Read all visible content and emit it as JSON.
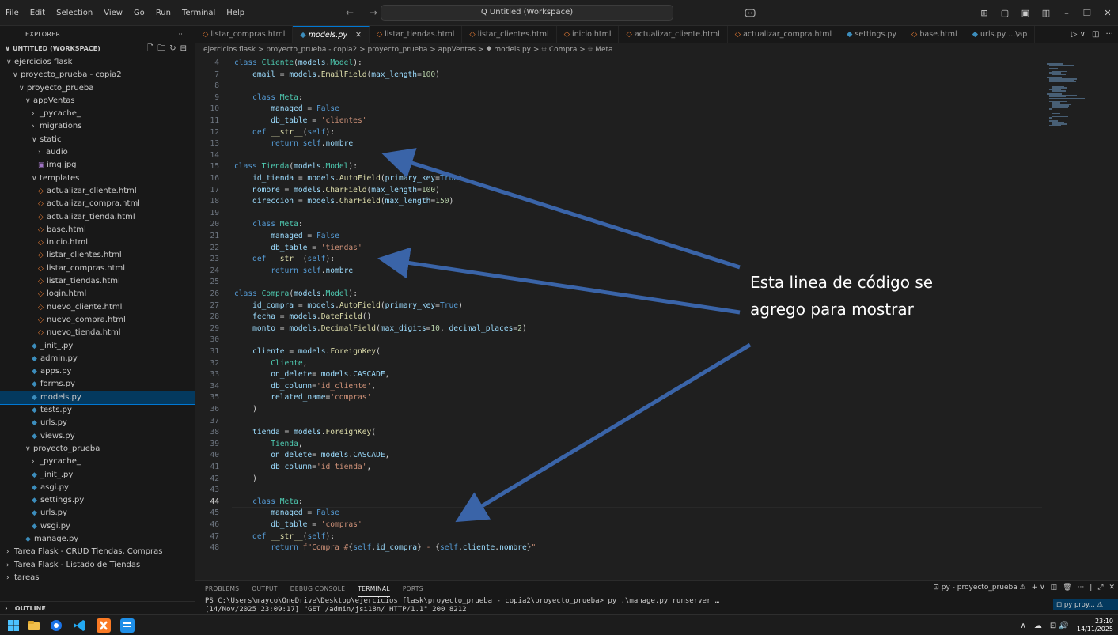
{
  "menu": [
    "File",
    "Edit",
    "Selection",
    "View",
    "Go",
    "Run",
    "Terminal",
    "Help"
  ],
  "nav_arrows": "← →",
  "command_center": "Q Untitled (Workspace)",
  "window_controls": [
    "⊞",
    "▢",
    "▣",
    "▥",
    "–",
    "❐",
    "✕"
  ],
  "explorer": {
    "title": "EXPLORER",
    "more": "···",
    "workspace": "UNTITLED (WORKSPACE)",
    "ws_actions": [
      "🗋",
      "🗀",
      "↻",
      "⊟"
    ],
    "tree": [
      {
        "label": "ejercicios flask",
        "indent": 0,
        "type": "folder",
        "open": true
      },
      {
        "label": "proyecto_prueba - copia2",
        "indent": 1,
        "type": "folder",
        "open": true
      },
      {
        "label": "proyecto_prueba",
        "indent": 2,
        "type": "folder",
        "open": true
      },
      {
        "label": "appVentas",
        "indent": 3,
        "type": "folder",
        "open": true
      },
      {
        "label": "_pycache_",
        "indent": 4,
        "type": "folder",
        "open": false
      },
      {
        "label": "migrations",
        "indent": 4,
        "type": "folder",
        "open": false
      },
      {
        "label": "static",
        "indent": 4,
        "type": "folder",
        "open": true
      },
      {
        "label": "audio",
        "indent": 5,
        "type": "folder",
        "open": false
      },
      {
        "label": "img.jpg",
        "indent": 5,
        "type": "img"
      },
      {
        "label": "templates",
        "indent": 4,
        "type": "folder",
        "open": true
      },
      {
        "label": "actualizar_cliente.html",
        "indent": 5,
        "type": "html"
      },
      {
        "label": "actualizar_compra.html",
        "indent": 5,
        "type": "html"
      },
      {
        "label": "actualizar_tienda.html",
        "indent": 5,
        "type": "html"
      },
      {
        "label": "base.html",
        "indent": 5,
        "type": "html"
      },
      {
        "label": "inicio.html",
        "indent": 5,
        "type": "html"
      },
      {
        "label": "listar_clientes.html",
        "indent": 5,
        "type": "html"
      },
      {
        "label": "listar_compras.html",
        "indent": 5,
        "type": "html"
      },
      {
        "label": "listar_tiendas.html",
        "indent": 5,
        "type": "html"
      },
      {
        "label": "login.html",
        "indent": 5,
        "type": "html"
      },
      {
        "label": "nuevo_cliente.html",
        "indent": 5,
        "type": "html"
      },
      {
        "label": "nuevo_compra.html",
        "indent": 5,
        "type": "html"
      },
      {
        "label": "nuevo_tienda.html",
        "indent": 5,
        "type": "html"
      },
      {
        "label": "_init_.py",
        "indent": 4,
        "type": "py"
      },
      {
        "label": "admin.py",
        "indent": 4,
        "type": "py"
      },
      {
        "label": "apps.py",
        "indent": 4,
        "type": "py"
      },
      {
        "label": "forms.py",
        "indent": 4,
        "type": "py"
      },
      {
        "label": "models.py",
        "indent": 4,
        "type": "py",
        "selected": true
      },
      {
        "label": "tests.py",
        "indent": 4,
        "type": "py"
      },
      {
        "label": "urls.py",
        "indent": 4,
        "type": "py"
      },
      {
        "label": "views.py",
        "indent": 4,
        "type": "py"
      },
      {
        "label": "proyecto_prueba",
        "indent": 3,
        "type": "folder",
        "open": true
      },
      {
        "label": "_pycache_",
        "indent": 4,
        "type": "folder",
        "open": false
      },
      {
        "label": "_init_.py",
        "indent": 4,
        "type": "py"
      },
      {
        "label": "asgi.py",
        "indent": 4,
        "type": "py"
      },
      {
        "label": "settings.py",
        "indent": 4,
        "type": "py"
      },
      {
        "label": "urls.py",
        "indent": 4,
        "type": "py"
      },
      {
        "label": "wsgi.py",
        "indent": 4,
        "type": "py"
      },
      {
        "label": "manage.py",
        "indent": 3,
        "type": "py"
      },
      {
        "label": "Tarea Flask - CRUD Tiendas, Compras",
        "indent": 0,
        "type": "folder",
        "open": false
      },
      {
        "label": "Tarea Flask - Listado de Tiendas",
        "indent": 0,
        "type": "folder",
        "open": false
      },
      {
        "label": "tareas",
        "indent": 0,
        "type": "folder",
        "open": false
      }
    ],
    "outline": "OUTLINE"
  },
  "tabs": [
    {
      "label": "listar_compras.html",
      "type": "html"
    },
    {
      "label": "models.py",
      "type": "py",
      "active": true
    },
    {
      "label": "listar_tiendas.html",
      "type": "html"
    },
    {
      "label": "listar_clientes.html",
      "type": "html"
    },
    {
      "label": "inicio.html",
      "type": "html"
    },
    {
      "label": "actualizar_cliente.html",
      "type": "html"
    },
    {
      "label": "actualizar_compra.html",
      "type": "html"
    },
    {
      "label": "settings.py",
      "type": "py"
    },
    {
      "label": "base.html",
      "type": "html"
    },
    {
      "label": "urls.py ...\\ap",
      "type": "py"
    }
  ],
  "tab_actions": [
    "▷ ∨",
    "◫",
    "···"
  ],
  "breadcrumb": "ejercicios flask > proyecto_prueba - copia2 > proyecto_prueba > appVentas > ⯁ models.py > ⯐ Compra > ⯐ Meta",
  "code": [
    {
      "ln": "4",
      "segs": [
        [
          "kw",
          "class "
        ],
        [
          "cls",
          "Cliente"
        ],
        [
          "",
          "("
        ],
        [
          "var",
          "models"
        ],
        [
          "",
          "."
        ],
        [
          "cls",
          "Model"
        ],
        [
          "",
          "):"
        ]
      ]
    },
    {
      "ln": "7",
      "segs": [
        [
          "var",
          "    email"
        ],
        [
          "",
          " = "
        ],
        [
          "var",
          "models"
        ],
        [
          "",
          "."
        ],
        [
          "fn",
          "EmailField"
        ],
        [
          "",
          "("
        ],
        [
          "var",
          "max_length"
        ],
        [
          "",
          "="
        ],
        [
          "num",
          "100"
        ],
        [
          "",
          ")"
        ]
      ]
    },
    {
      "ln": "8",
      "segs": []
    },
    {
      "ln": "9",
      "segs": [
        [
          "kw",
          "    class "
        ],
        [
          "cls",
          "Meta"
        ],
        [
          "",
          ":"
        ]
      ]
    },
    {
      "ln": "10",
      "segs": [
        [
          "var",
          "        managed"
        ],
        [
          "",
          " = "
        ],
        [
          "kw",
          "False"
        ]
      ]
    },
    {
      "ln": "11",
      "segs": [
        [
          "var",
          "        db_table"
        ],
        [
          "",
          " = "
        ],
        [
          "str",
          "'clientes'"
        ]
      ]
    },
    {
      "ln": "12",
      "segs": [
        [
          "kw",
          "    def "
        ],
        [
          "fn",
          "__str__"
        ],
        [
          "",
          "("
        ],
        [
          "self",
          "self"
        ],
        [
          "",
          "):"
        ]
      ]
    },
    {
      "ln": "13",
      "segs": [
        [
          "kw",
          "        return "
        ],
        [
          "self",
          "self"
        ],
        [
          "",
          "."
        ],
        [
          "var",
          "nombre"
        ]
      ]
    },
    {
      "ln": "14",
      "segs": []
    },
    {
      "ln": "15",
      "segs": [
        [
          "kw",
          "class "
        ],
        [
          "cls",
          "Tienda"
        ],
        [
          "",
          "("
        ],
        [
          "var",
          "models"
        ],
        [
          "",
          "."
        ],
        [
          "cls",
          "Model"
        ],
        [
          "",
          "):"
        ]
      ]
    },
    {
      "ln": "16",
      "segs": [
        [
          "var",
          "    id_tienda"
        ],
        [
          "",
          " = "
        ],
        [
          "var",
          "models"
        ],
        [
          "",
          "."
        ],
        [
          "fn",
          "AutoField"
        ],
        [
          "",
          "("
        ],
        [
          "var",
          "primary_key"
        ],
        [
          "",
          "="
        ],
        [
          "kw",
          "True"
        ],
        [
          "",
          ")"
        ]
      ]
    },
    {
      "ln": "17",
      "segs": [
        [
          "var",
          "    nombre"
        ],
        [
          "",
          " = "
        ],
        [
          "var",
          "models"
        ],
        [
          "",
          "."
        ],
        [
          "fn",
          "CharField"
        ],
        [
          "",
          "("
        ],
        [
          "var",
          "max_length"
        ],
        [
          "",
          "="
        ],
        [
          "num",
          "100"
        ],
        [
          "",
          ")"
        ]
      ]
    },
    {
      "ln": "18",
      "segs": [
        [
          "var",
          "    direccion"
        ],
        [
          "",
          " = "
        ],
        [
          "var",
          "models"
        ],
        [
          "",
          "."
        ],
        [
          "fn",
          "CharField"
        ],
        [
          "",
          "("
        ],
        [
          "var",
          "max_length"
        ],
        [
          "",
          "="
        ],
        [
          "num",
          "150"
        ],
        [
          "",
          ")"
        ]
      ]
    },
    {
      "ln": "19",
      "segs": []
    },
    {
      "ln": "20",
      "segs": [
        [
          "kw",
          "    class "
        ],
        [
          "cls",
          "Meta"
        ],
        [
          "",
          ":"
        ]
      ]
    },
    {
      "ln": "21",
      "segs": [
        [
          "var",
          "        managed"
        ],
        [
          "",
          " = "
        ],
        [
          "kw",
          "False"
        ]
      ]
    },
    {
      "ln": "22",
      "segs": [
        [
          "var",
          "        db_table"
        ],
        [
          "",
          " = "
        ],
        [
          "str",
          "'tiendas'"
        ]
      ]
    },
    {
      "ln": "23",
      "segs": [
        [
          "kw",
          "    def "
        ],
        [
          "fn",
          "__str__"
        ],
        [
          "",
          "("
        ],
        [
          "self",
          "self"
        ],
        [
          "",
          "):"
        ]
      ]
    },
    {
      "ln": "24",
      "segs": [
        [
          "kw",
          "        return "
        ],
        [
          "self",
          "self"
        ],
        [
          "",
          "."
        ],
        [
          "var",
          "nombre"
        ]
      ]
    },
    {
      "ln": "25",
      "segs": []
    },
    {
      "ln": "26",
      "segs": [
        [
          "kw",
          "class "
        ],
        [
          "cls",
          "Compra"
        ],
        [
          "",
          "("
        ],
        [
          "var",
          "models"
        ],
        [
          "",
          "."
        ],
        [
          "cls",
          "Model"
        ],
        [
          "",
          "):"
        ]
      ]
    },
    {
      "ln": "27",
      "segs": [
        [
          "var",
          "    id_compra"
        ],
        [
          "",
          " = "
        ],
        [
          "var",
          "models"
        ],
        [
          "",
          "."
        ],
        [
          "fn",
          "AutoField"
        ],
        [
          "",
          "("
        ],
        [
          "var",
          "primary_key"
        ],
        [
          "",
          "="
        ],
        [
          "kw",
          "True"
        ],
        [
          "",
          ")"
        ]
      ]
    },
    {
      "ln": "28",
      "segs": [
        [
          "var",
          "    fecha"
        ],
        [
          "",
          " = "
        ],
        [
          "var",
          "models"
        ],
        [
          "",
          "."
        ],
        [
          "fn",
          "DateField"
        ],
        [
          "",
          "()"
        ]
      ]
    },
    {
      "ln": "29",
      "segs": [
        [
          "var",
          "    monto"
        ],
        [
          "",
          " = "
        ],
        [
          "var",
          "models"
        ],
        [
          "",
          "."
        ],
        [
          "fn",
          "DecimalField"
        ],
        [
          "",
          "("
        ],
        [
          "var",
          "max_digits"
        ],
        [
          "",
          "="
        ],
        [
          "num",
          "10"
        ],
        [
          "",
          ", "
        ],
        [
          "var",
          "decimal_places"
        ],
        [
          "",
          "="
        ],
        [
          "num",
          "2"
        ],
        [
          "",
          ")"
        ]
      ]
    },
    {
      "ln": "30",
      "segs": []
    },
    {
      "ln": "31",
      "segs": [
        [
          "var",
          "    cliente"
        ],
        [
          "",
          " = "
        ],
        [
          "var",
          "models"
        ],
        [
          "",
          "."
        ],
        [
          "fn",
          "ForeignKey"
        ],
        [
          "",
          "("
        ]
      ]
    },
    {
      "ln": "32",
      "segs": [
        [
          "cls",
          "        Cliente"
        ],
        [
          "",
          ","
        ]
      ]
    },
    {
      "ln": "33",
      "segs": [
        [
          "var",
          "        on_delete"
        ],
        [
          "",
          "= "
        ],
        [
          "var",
          "models"
        ],
        [
          "",
          "."
        ],
        [
          "var",
          "CASCADE"
        ],
        [
          "",
          ","
        ]
      ]
    },
    {
      "ln": "34",
      "segs": [
        [
          "var",
          "        db_column"
        ],
        [
          "",
          "="
        ],
        [
          "str",
          "'id_cliente'"
        ],
        [
          "",
          ","
        ]
      ]
    },
    {
      "ln": "35",
      "segs": [
        [
          "var",
          "        related_name"
        ],
        [
          "",
          "="
        ],
        [
          "str",
          "'compras'"
        ]
      ]
    },
    {
      "ln": "36",
      "segs": [
        [
          "",
          "    )"
        ]
      ]
    },
    {
      "ln": "37",
      "segs": []
    },
    {
      "ln": "38",
      "segs": [
        [
          "var",
          "    tienda"
        ],
        [
          "",
          " = "
        ],
        [
          "var",
          "models"
        ],
        [
          "",
          "."
        ],
        [
          "fn",
          "ForeignKey"
        ],
        [
          "",
          "("
        ]
      ]
    },
    {
      "ln": "39",
      "segs": [
        [
          "cls",
          "        Tienda"
        ],
        [
          "",
          ","
        ]
      ]
    },
    {
      "ln": "40",
      "segs": [
        [
          "var",
          "        on_delete"
        ],
        [
          "",
          "= "
        ],
        [
          "var",
          "models"
        ],
        [
          "",
          "."
        ],
        [
          "var",
          "CASCADE"
        ],
        [
          "",
          ","
        ]
      ]
    },
    {
      "ln": "41",
      "segs": [
        [
          "var",
          "        db_column"
        ],
        [
          "",
          "="
        ],
        [
          "str",
          "'id_tienda'"
        ],
        [
          "",
          ","
        ]
      ]
    },
    {
      "ln": "42",
      "segs": [
        [
          "",
          "    )"
        ]
      ]
    },
    {
      "ln": "43",
      "segs": []
    },
    {
      "ln": "44",
      "segs": [
        [
          "kw",
          "    class "
        ],
        [
          "cls",
          "Meta"
        ],
        [
          "",
          ":"
        ]
      ],
      "current": true
    },
    {
      "ln": "45",
      "segs": [
        [
          "var",
          "        managed"
        ],
        [
          "",
          " = "
        ],
        [
          "kw",
          "False"
        ]
      ]
    },
    {
      "ln": "46",
      "segs": [
        [
          "var",
          "        db_table"
        ],
        [
          "",
          " = "
        ],
        [
          "str",
          "'compras'"
        ]
      ]
    },
    {
      "ln": "47",
      "segs": [
        [
          "kw",
          "    def "
        ],
        [
          "fn",
          "__str__"
        ],
        [
          "",
          "("
        ],
        [
          "self",
          "self"
        ],
        [
          "",
          "):"
        ]
      ]
    },
    {
      "ln": "48",
      "segs": [
        [
          "kw",
          "        return "
        ],
        [
          "str",
          "f\"Compra #"
        ],
        [
          "",
          "{"
        ],
        [
          "self",
          "self"
        ],
        [
          "",
          "."
        ],
        [
          "var",
          "id_compra"
        ],
        [
          "",
          "}"
        ],
        [
          "str",
          " - "
        ],
        [
          "",
          "{"
        ],
        [
          "self",
          "self"
        ],
        [
          "",
          "."
        ],
        [
          "var",
          "cliente"
        ],
        [
          "",
          "."
        ],
        [
          "var",
          "nombre"
        ],
        [
          "",
          "}"
        ],
        [
          "str",
          "\""
        ]
      ]
    }
  ],
  "annotation": {
    "line1": "Esta linea de código se",
    "line2": "agrego para mostrar"
  },
  "panel": {
    "tabs": [
      "PROBLEMS",
      "OUTPUT",
      "DEBUG CONSOLE",
      "TERMINAL",
      "PORTS"
    ],
    "active_tab": "TERMINAL",
    "actions": [
      "⊡ py - proyecto_prueba ⚠",
      "+ ∨",
      "◫",
      "🗑",
      "···",
      "|",
      "⤢",
      "✕"
    ],
    "terminal_lines": [
      "PS C:\\Users\\mayco\\OneDrive\\Desktop\\ejercicios flask\\proyecto_prueba - copia2\\proyecto_prueba> py .\\manage.py runserver …",
      "[14/Nov/2025 23:09:17] \"GET /admin/jsi18n/ HTTP/1.1\" 200 8212"
    ],
    "term_item": "⊡ py proy... ⚠"
  },
  "taskbar": {
    "tray": [
      "∧",
      "☁",
      "⊡ 🔊"
    ],
    "time": "23:10",
    "date": "14/11/2025"
  },
  "colors": {
    "accent": "#0078d4",
    "annotation_arrow": "#3a64a8"
  }
}
